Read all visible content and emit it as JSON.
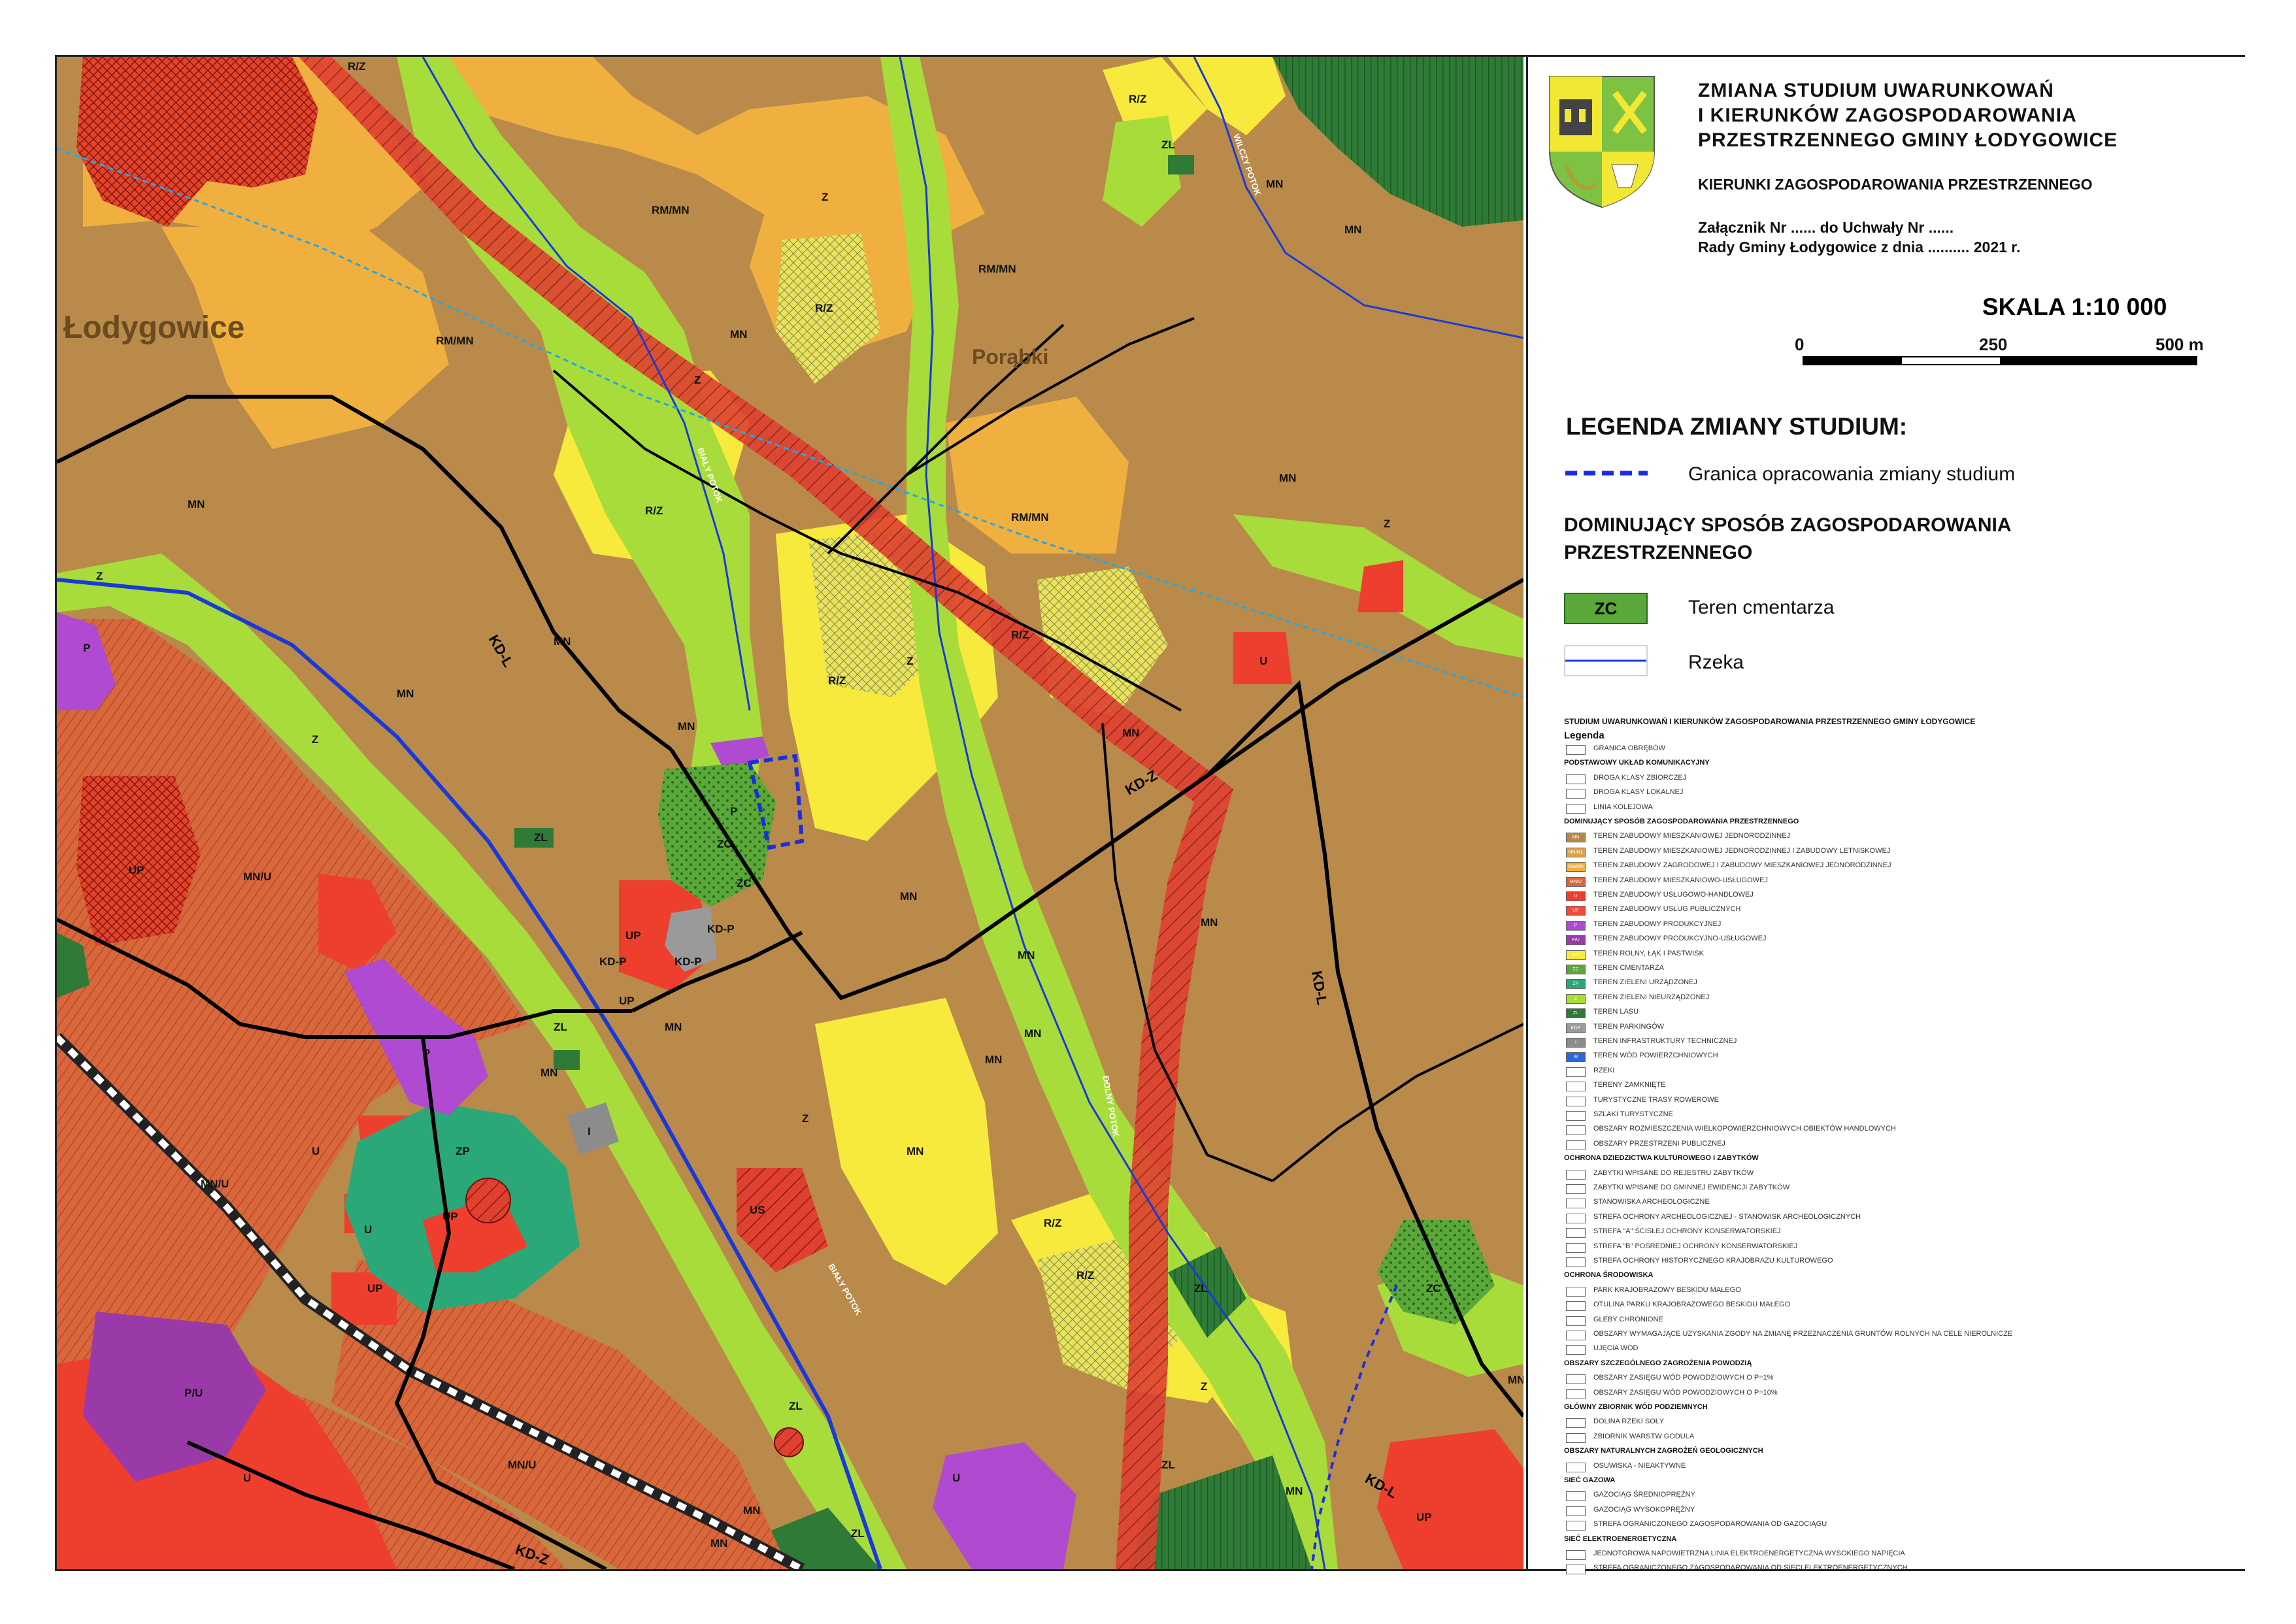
{
  "title": {
    "line1": "ZMIANA STUDIUM UWARUNKOWAŃ",
    "line2": "I KIERUNKÓW ZAGOSPODAROWANIA",
    "line3": "PRZESTRZENNEGO GMINY ŁODYGOWICE",
    "subtitle": "KIERUNKI ZAGOSPODAROWANIA PRZESTRZENNEGO",
    "attach1": "Załącznik Nr ...... do Uchwały Nr ......",
    "attach2": "Rady Gminy Łodygowice z dnia .......... 2021 r."
  },
  "scale": {
    "label": "SKALA 1:10 000",
    "ticks": [
      "0",
      "250",
      "500 m"
    ]
  },
  "legend_change": {
    "heading": "LEGENDA ZMIANY STUDIUM:",
    "boundary": "Granica opracowania zmiany studium",
    "dominant_heading_1": "DOMINUJĄCY SPOSÓB ZAGOSPODAROWANIA",
    "dominant_heading_2": "PRZESTRZENNEGO",
    "cemetery_symbol": "ZC",
    "cemetery": "Teren cmentarza",
    "river": "Rzeka"
  },
  "legend_full": {
    "title": "STUDIUM UWARUNKOWAŃ I KIERUNKÓW ZAGOSPODAROWANIA PRZESTRZENNEGO GMINY ŁODYGOWICE",
    "legenda": "Legenda",
    "granica_obrebow": "GRANICA OBRĘBÓW",
    "uklad_heading": "PODSTAWOWY UKŁAD KOMUNIKACYJNY",
    "droga_zbiorcza": "DROGA KLASY ZBIORCZEJ",
    "droga_lokalna": "DROGA KLASY LOKALNEJ",
    "linia_kolejowa": "LINIA KOLEJOWA",
    "dominujacy_heading": "DOMINUJĄCY SPOSÓB ZAGOSPODAROWANIA PRZESTRZENNEGO",
    "zones": [
      {
        "code": "MN",
        "text": "TEREN ZABUDOWY MIESZKANIOWEJ JEDNORODZINNEJ",
        "color": "#b8874a"
      },
      {
        "code": "MN/ML",
        "text": "TEREN ZABUDOWY MIESZKANIOWEJ JEDNORODZINNEJ I ZABUDOWY LETNISKOWEJ",
        "color": "#d9a24e"
      },
      {
        "code": "RM/MN",
        "text": "TEREN ZABUDOWY ZAGRODOWEJ I ZABUDOWY MIESZKANIOWEJ JEDNORODZINNEJ",
        "color": "#f0b040"
      },
      {
        "code": "MN/U",
        "text": "TEREN ZABUDOWY MIESZKANIOWO-USŁUGOWEJ",
        "color": "#d8683c"
      },
      {
        "code": "U",
        "text": "TEREN ZABUDOWY USŁUGOWO-HANDLOWEJ",
        "color": "#ee3e2e"
      },
      {
        "code": "UP",
        "text": "TEREN ZABUDOWY USŁUG PUBLICZNYCH",
        "color": "#f04a3a"
      },
      {
        "code": "P",
        "text": "TEREN ZABUDOWY PRODUKCYJNEJ",
        "color": "#b04ad0"
      },
      {
        "code": "P/U",
        "text": "TEREN ZABUDOWY PRODUKCYJNO-USŁUGOWEJ",
        "color": "#9a3aa8"
      },
      {
        "code": "R/Z",
        "text": "TEREN ROLNY, ŁĄK I PASTWISK",
        "color": "#f7ea3c"
      },
      {
        "code": "ZC",
        "text": "TEREN CMENTARZA",
        "color": "#5aa83a"
      },
      {
        "code": "ZP",
        "text": "TEREN ZIELENI URZĄDZONEJ",
        "color": "#2aa878"
      },
      {
        "code": "Z",
        "text": "TEREN ZIELENI NIEURZĄDZONEJ",
        "color": "#a8dc3a"
      },
      {
        "code": "ZL",
        "text": "TEREN LASU",
        "color": "#2e7a36"
      },
      {
        "code": "KDP",
        "text": "TEREN PARKINGÓW",
        "color": "#9a9a9a"
      },
      {
        "code": "I",
        "text": "TEREN INFRASTRUKTURY TECHNICZNEJ",
        "color": "#8c8c8c"
      },
      {
        "code": "W",
        "text": "TEREN WÓD POWIERZCHNIOWYCH",
        "color": "#2a6ad8"
      }
    ],
    "rzeki": "RZEKI",
    "tereny_zamkniete": "TERENY ZAMKNIĘTE",
    "trasy_rowerowe": "TURYSTYCZNE TRASY ROWEROWE",
    "szlaki": "SZLAKI TURYSTYCZNE",
    "wielkopowierzchniowe": "OBSZARY ROZMIESZCZENIA WIELKOPOWIERZCHNIOWYCH OBIEKTÓW HANDLOWYCH",
    "przestrzenie_publiczne": "OBSZARY PRZESTRZENI PUBLICZNEJ",
    "ochrona_dziedzictwa": "OCHRONA DZIEDZICTWA KULTUROWEGO I ZABYTKÓW",
    "rejestr": "ZABYTKI WPISANE DO REJESTRU ZABYTKÓW",
    "ewidencja": "ZABYTKI WPISANE DO GMINNEJ EWIDENCJI ZABYTKÓW",
    "stanowiska": "STANOWISKA ARCHEOLOGICZNE",
    "strefa_arch": "STREFA OCHRONY ARCHEOLOGICZNEJ - STANOWISK ARCHEOLOGICZNYCH",
    "strefa_a": "STREFA \"A\" ŚCISŁEJ OCHRONY KONSERWATORSKIEJ",
    "strefa_b": "STREFA \"B\" POŚREDNIEJ OCHRONY KONSERWATORSKIEJ",
    "strefa_hist": "STREFA OCHRONY HISTORYCZNEGO KRAJOBRAZU KULTUROWEGO",
    "ochrona_srodowiska": "OCHRONA ŚRODOWISKA",
    "park": "PARK KRAJOBRAZOWY BESKIDU MAŁEGO",
    "otulina": "OTULINA PARKU KRAJOBRAZOWEGO BESKIDU MAŁEGO",
    "gleby": "GLEBY CHRONIONE",
    "zgoda": "OBSZARY WYMAGAJĄCE UZYSKANIA ZGODY NA ZMIANĘ PRZEZNACZENIA GRUNTÓW ROLNYCH NA CELE NIEROLNICZE",
    "ujecia": "UJĘCIA WÓD",
    "powodz_heading": "OBSZARY SZCZEGÓLNEGO ZAGROŻENIA POWODZIĄ",
    "p1": "OBSZARY ZASIĘGU WÓD POWODZIOWYCH  O P=1%",
    "p10": "OBSZARY ZASIĘGU WÓD POWODZIOWYCH  O P=10%",
    "gzwp_heading": "GŁÓWNY ZBIORNIK WÓD PODZIEMNYCH",
    "dolina": "DOLINA RZEKI SOŁY",
    "zbiornik": "ZBIORNIK WARSTW GODULA",
    "geo_heading": "OBSZARY NATURALNYCH ZAGROŻEŃ GEOLOGICZNYCH",
    "osuwiska": "OSUWISKA - NIEAKTYWNE",
    "gaz_heading": "SIEĆ GAZOWA",
    "gaz_sr": "GAZOCIĄG ŚREDNIOPRĘŻNY",
    "gaz_wys": "GAZOCIĄG WYSOKOPRĘŻNY",
    "gaz_strefa": "STREFA OGRANICZONEGO ZAGOSPODAROWANIA OD GAZOCIĄGU",
    "ee_heading": "SIEĆ ELEKTROENERGETYCZNA",
    "ee_linia": "JEDNOTOROWA NAPOWIETRZNA LINIA ELEKTROENERGETYCZNA WYSOKIEGO NAPIĘCIA",
    "ee_strefa": "STREFA OGRANICZONEGO ZAGOSPODAROWANIA OD SIECI ELEKTROENERGETYCZNYCH"
  },
  "map_labels": {
    "town": "Łodygowice",
    "porabki": "Porąbki",
    "roads": {
      "kdl": "KD-L",
      "kdz": "KD-Z",
      "kdp": "KD-P"
    },
    "streams": {
      "bialy": "BIAŁY POTOK",
      "dolny": "DOLNY POTOK",
      "bialy2": "BIAŁY POTOK",
      "wilczy": "WILCZY POTOK"
    },
    "zones": [
      "R/Z",
      "R/Z",
      "MN",
      "RM/MN",
      "Z",
      "MN",
      "RM/MN",
      "R/Z",
      "RM/MN",
      "MN",
      "ZL",
      "R/Z",
      "MN",
      "Z",
      "MN",
      "R/Z",
      "RM/MN",
      "MN",
      "Z",
      "MN",
      "Z",
      "R/Z",
      "Z",
      "MN",
      "U",
      "P",
      "Z",
      "MN",
      "MN",
      "ZL",
      "UP",
      "MN/U",
      "P",
      "ZC",
      "UP",
      "UP",
      "MN",
      "MN",
      "ZL",
      "P",
      "MN",
      "ZP",
      "MN",
      "MN/U",
      "U",
      "UP",
      "U",
      "I",
      "UP",
      "US",
      "MN",
      "Z",
      "R/Z",
      "MN",
      "MN",
      "ZL",
      "ZC",
      "P/U",
      "U",
      "MN/U",
      "ZL",
      "U",
      "UP",
      "MN",
      "Z",
      "ZC",
      "ZL",
      "MN",
      "R/Z",
      "MN",
      "MN",
      "KD-P",
      "KD-P",
      "KD-P",
      "ZL"
    ]
  },
  "colors": {
    "mn": "#b8874a",
    "rmmn": "#f0b040",
    "rz": "#f7ea3c",
    "z": "#a8dc3a",
    "zl": "#2e7a36",
    "u": "#ee3e2e",
    "p": "#b04ad0",
    "mnu": "#d8683c",
    "zp": "#2aa878",
    "road": "#000000",
    "boundary": "#1a2ee0",
    "power": "#22a8e8"
  }
}
